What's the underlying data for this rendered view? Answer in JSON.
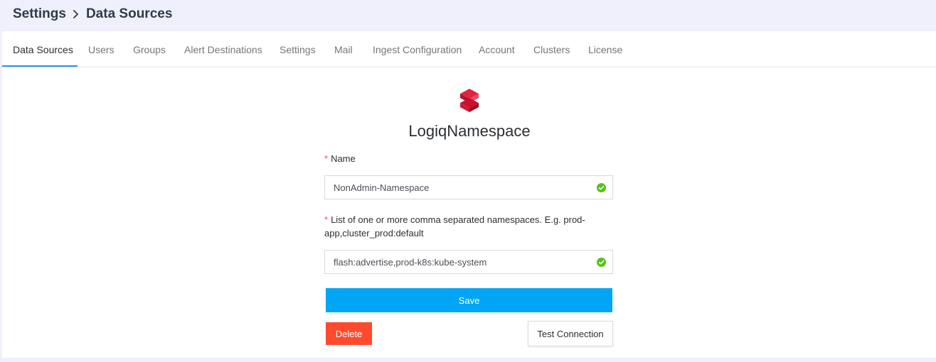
{
  "breadcrumb": {
    "parent": "Settings",
    "separator_icon": "chevron-right-icon",
    "current": "Data Sources"
  },
  "tabs": [
    {
      "label": "Data Sources",
      "active": true
    },
    {
      "label": "Users",
      "active": false
    },
    {
      "label": "Groups",
      "active": false
    },
    {
      "label": "Alert Destinations",
      "active": false
    },
    {
      "label": "Settings",
      "active": false
    },
    {
      "label": "Mail",
      "active": false
    },
    {
      "label": "Ingest Configuration",
      "active": false
    },
    {
      "label": "Account",
      "active": false
    },
    {
      "label": "Clusters",
      "active": false
    },
    {
      "label": "License",
      "active": false
    }
  ],
  "datasource": {
    "logo_icon": "logiq-logo-icon",
    "title": "LogiqNamespace"
  },
  "form": {
    "required_marker": "*",
    "name": {
      "label": "Name",
      "value": "NonAdmin-Namespace",
      "status_icon": "check-circle-icon"
    },
    "namespaces": {
      "label": "List of one or more comma separated namespaces. E.g. prod-app,cluster_prod:default",
      "value": "flash:advertise,prod-k8s:kube-system",
      "status_icon": "check-circle-icon"
    }
  },
  "actions": {
    "save_label": "Save",
    "delete_label": "Delete",
    "test_label": "Test Connection"
  },
  "colors": {
    "page_background": "#eff0fb",
    "tab_active_underline": "#2196f3",
    "save_button": "#00a5f5",
    "delete_button": "#ff4a2e",
    "success_check": "#52c41a",
    "required_marker": "#ff4d4f",
    "logo": "#c8102e"
  }
}
